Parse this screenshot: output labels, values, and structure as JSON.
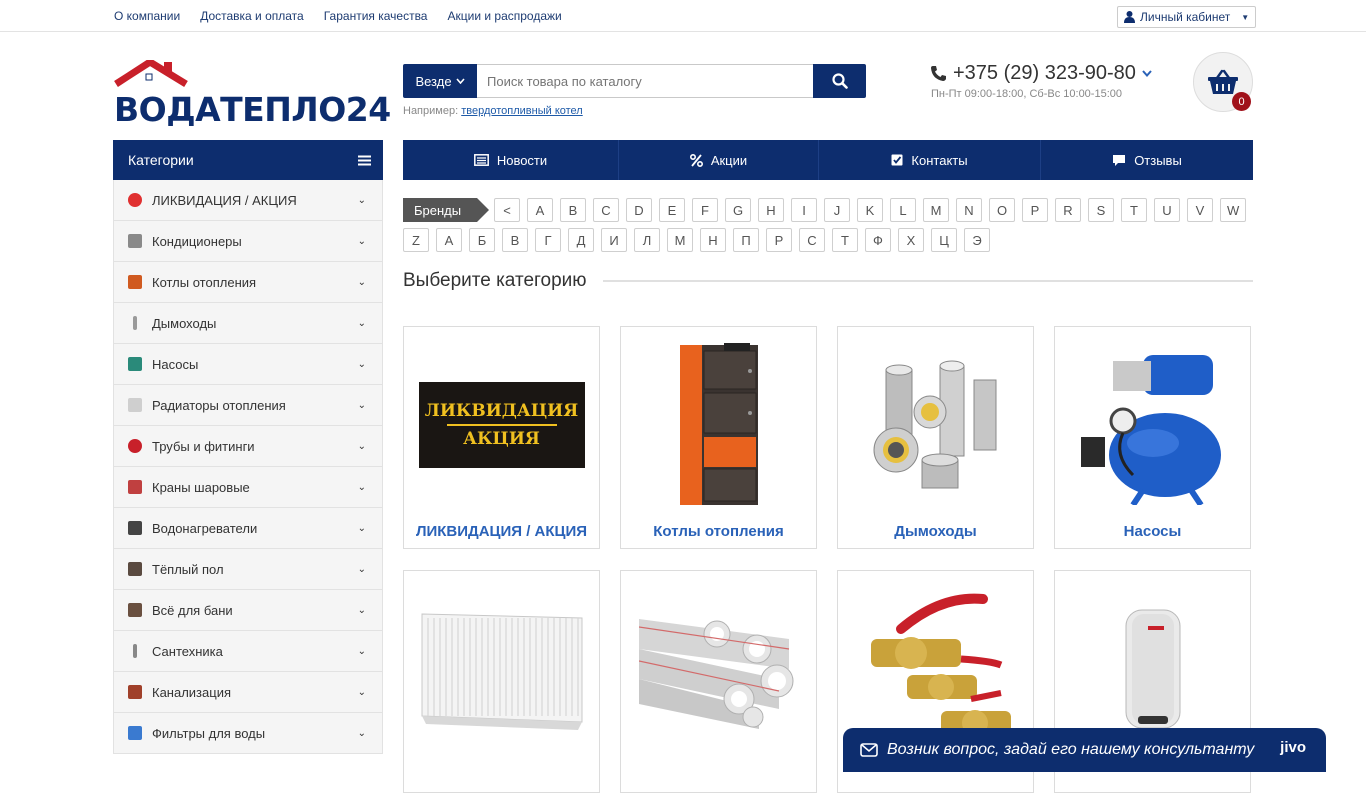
{
  "topbar": {
    "links": [
      "О компании",
      "Доставка и оплата",
      "Гарантия качества",
      "Акции и распродажи"
    ],
    "cabinet": "Личный кабинет"
  },
  "logo": {
    "text": "ВОДАТЕПЛО24"
  },
  "search": {
    "scope": "Везде",
    "placeholder": "Поиск товара по каталогу",
    "example_prefix": "Например:",
    "example_link": "твердотопливный котел"
  },
  "contacts": {
    "phone": "+375 (29) 323-90-80",
    "hours": "Пн-Пт 09:00-18:00, Сб-Вс 10:00-15:00"
  },
  "cart": {
    "count": "0"
  },
  "sidebar": {
    "title": "Категории",
    "items": [
      {
        "label": "ЛИКВИДАЦИЯ / АКЦИЯ",
        "icon": "percent-icon",
        "color": "#e03030"
      },
      {
        "label": "Кондиционеры",
        "icon": "air-conditioner-icon",
        "color": "#8a8a8a"
      },
      {
        "label": "Котлы отопления",
        "icon": "boiler-icon",
        "color": "#d05a20"
      },
      {
        "label": "Дымоходы",
        "icon": "chimney-icon",
        "color": "#9a9a9a"
      },
      {
        "label": "Насосы",
        "icon": "pump-icon",
        "color": "#2a8a7a"
      },
      {
        "label": "Радиаторы отопления",
        "icon": "radiator-icon",
        "color": "#cfcfcf"
      },
      {
        "label": "Трубы и фитинги",
        "icon": "pipe-icon",
        "color": "#c8202a"
      },
      {
        "label": "Краны шаровые",
        "icon": "valve-icon",
        "color": "#c04040"
      },
      {
        "label": "Водонагреватели",
        "icon": "water-heater-icon",
        "color": "#444444"
      },
      {
        "label": "Тёплый пол",
        "icon": "heated-floor-icon",
        "color": "#5a4a40"
      },
      {
        "label": "Всё для бани",
        "icon": "sauna-icon",
        "color": "#6a5040"
      },
      {
        "label": "Сантехника",
        "icon": "faucet-icon",
        "color": "#888888"
      },
      {
        "label": "Канализация",
        "icon": "sewer-icon",
        "color": "#a0402a"
      },
      {
        "label": "Фильтры для воды",
        "icon": "filter-icon",
        "color": "#3a7ad0"
      }
    ]
  },
  "nav": {
    "tabs": [
      {
        "label": "Новости",
        "icon": "newspaper-icon"
      },
      {
        "label": "Акции",
        "icon": "percent-icon"
      },
      {
        "label": "Контакты",
        "icon": "contact-card-icon"
      },
      {
        "label": "Отзывы",
        "icon": "comment-icon"
      }
    ]
  },
  "brands": {
    "label": "Бренды",
    "row1": [
      "<",
      "A",
      "B",
      "C",
      "D",
      "E",
      "F",
      "G",
      "H",
      "I",
      "J",
      "K",
      "L",
      "M",
      "N",
      "O",
      "P",
      "R",
      "S",
      "T",
      "U",
      "V",
      "W"
    ],
    "row2": [
      "Z",
      "А",
      "Б",
      "В",
      "Г",
      "Д",
      "И",
      "Л",
      "М",
      "Н",
      "П",
      "Р",
      "С",
      "Т",
      "Ф",
      "Х",
      "Ц",
      "Э"
    ]
  },
  "main": {
    "title": "Выберите категорию",
    "cards": [
      {
        "name": "ЛИКВИДАЦИЯ / АКЦИЯ",
        "img_line1": "ЛИКВИДАЦИЯ",
        "img_line2": "АКЦИЯ"
      },
      {
        "name": "Котлы отопления"
      },
      {
        "name": "Дымоходы"
      },
      {
        "name": "Насосы"
      },
      {
        "name": ""
      },
      {
        "name": ""
      },
      {
        "name": ""
      },
      {
        "name": ""
      }
    ]
  },
  "chat": {
    "text": "Возник вопрос, задай его нашему консультанту",
    "brand": "jivo"
  },
  "colors": {
    "primary": "#0d2d6e",
    "link": "#2a62b8",
    "accent": "#a0111a"
  }
}
